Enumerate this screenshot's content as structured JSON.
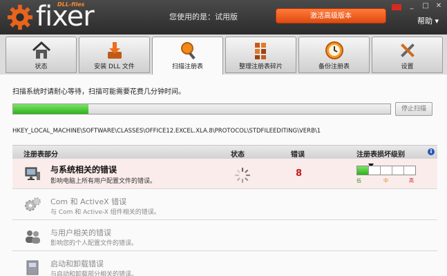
{
  "header": {
    "logo_small": "DLL-files",
    "logo_text": "fixer",
    "version_label": "您使用的是：试用版",
    "activate_button": "激活高级版本",
    "help": "帮助 ▾"
  },
  "tabs": [
    {
      "label": "状态",
      "icon": "home-icon"
    },
    {
      "label": "安装 DLL 文件",
      "icon": "download-icon"
    },
    {
      "label": "扫描注册表",
      "icon": "magnifier-icon"
    },
    {
      "label": "整理注册表碎片",
      "icon": "blocks-icon"
    },
    {
      "label": "备份注册表",
      "icon": "clock-icon"
    },
    {
      "label": "设置",
      "icon": "tools-icon"
    }
  ],
  "active_tab": "扫描注册表",
  "scan": {
    "waiting_text": "扫描系统时请耐心等待，扫描可能需要花费几分钟时间。",
    "progress": 0.2,
    "stop_button": "停止扫描",
    "current_path": "HKEY_LOCAL_MACHINE\\SOFTWARE\\CLASSES\\OFFICE12.EXCEL.XLA.8\\PROTOCOL\\STDFILEEDITING\\VERB\\1"
  },
  "table": {
    "headers": {
      "part": "注册表部分",
      "status": "状态",
      "errors": "错误",
      "level": "注册表损坏级别"
    },
    "rows": [
      {
        "title": "与系统相关的错误",
        "desc": "影响电脑上所有用户配置文件的错误。",
        "status": "scanning",
        "errors": "8",
        "active": true,
        "icon": "system-monitor-icon"
      },
      {
        "title": "Com 和  ActiveX 错误",
        "desc": "与 Com 和 Active-X 组件相关的错误。",
        "active": false,
        "icon": "gears-icon"
      },
      {
        "title": "与用户相关的错误",
        "desc": "影响您的个人配置文件的错误。",
        "active": false,
        "icon": "users-icon"
      },
      {
        "title": "启动和卸载错误",
        "desc": "与启动和卸载部分相关的错误。",
        "active": false,
        "icon": "installer-icon"
      }
    ],
    "level_labels": {
      "low": "低",
      "mid": "中",
      "high": "高"
    },
    "level_value": 0.2
  },
  "colors": {
    "accent": "#e85a1a",
    "progress": "#2db31a",
    "error": "#c21b1b",
    "highlight_row": "#fbecec"
  }
}
